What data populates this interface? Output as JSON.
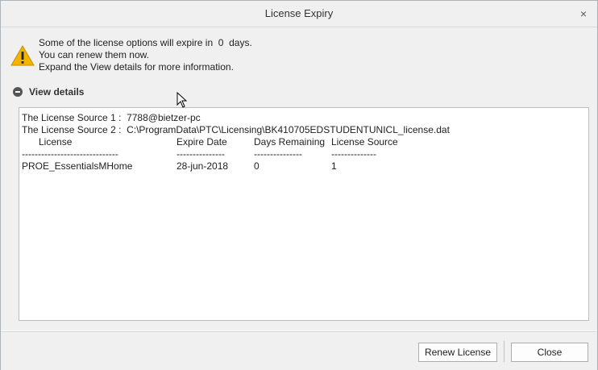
{
  "window": {
    "title": "License Expiry",
    "close_symbol": "×"
  },
  "message": {
    "line1": "Some of the license options will expire in  0  days.",
    "line2": "You can renew them now.",
    "line3": "Expand the View details for more information."
  },
  "details": {
    "label": "View details"
  },
  "details_text": {
    "source1": "The License Source 1 :  7788@bietzer-pc",
    "source2": "The License Source 2 :  C:\\ProgramData\\PTC\\Licensing\\BK410705EDSTUDENTUNICL_license.dat",
    "headers": [
      "License",
      "Expire Date",
      "Days Remaining",
      "License Source"
    ],
    "dashes": [
      "------------------------------",
      "---------------",
      "---------------",
      "--------------"
    ],
    "rows": [
      [
        "PROE_EssentialsMHome",
        "28-jun-2018",
        "0",
        "1"
      ]
    ]
  },
  "buttons": {
    "renew": "Renew License",
    "close": "Close"
  },
  "colors": {
    "warning": "#f2b400",
    "chrome": "#f0f0f0",
    "border": "#aeb3b8"
  }
}
